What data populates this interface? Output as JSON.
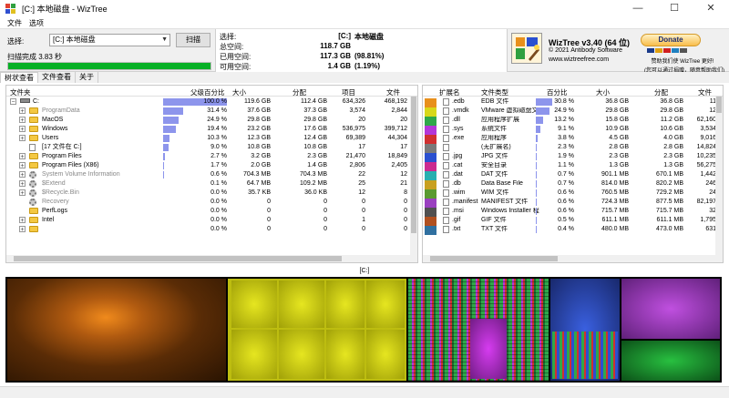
{
  "window": {
    "title": "[C:] 本地磁盘 - WizTree",
    "minimize": "—",
    "maximize": "☐",
    "close": "✕"
  },
  "menu": [
    "文件",
    "选项"
  ],
  "scan": {
    "select_label": "选择:",
    "drive_value": "[C:] 本地磁盘",
    "scan_button": "扫描",
    "status": "扫描完成 3.83 秒",
    "progress_percent": 100
  },
  "stats": {
    "select_label": "选择:",
    "select_value": "[C:]",
    "drive_name": "本地磁盘",
    "total_label": "总空间:",
    "total": "118.7 GB",
    "used_label": "已用空间:",
    "used": "117.3 GB",
    "used_pct": "(98.81%)",
    "free_label": "可用空间:",
    "free": "1.4 GB",
    "free_pct": "(1.19%)"
  },
  "about": {
    "name": "WizTree v3.40 (64 位)",
    "copyright": "© 2021 Antibody Software",
    "url": "www.wiztreefree.com",
    "donate": "Donate",
    "donate_note": "赞助我们使 WizTree 更好!",
    "help_note": "(您可以通过捐赠，随意帮助我们)"
  },
  "colors": {
    "bar": "#8d95ec",
    "progress": "#06b025",
    "folder": "#f4c842"
  },
  "tabs": [
    "树状查看",
    "文件查看",
    "关于"
  ],
  "tree": {
    "headers": {
      "name": "文件夹",
      "pct": "父级百分比",
      "size": "大小",
      "alloc": "分配",
      "items": "项目",
      "files": "文件"
    },
    "rows": [
      {
        "name": "C:",
        "pct": 100.0,
        "pct_text": "100.0 %",
        "size": "119.6 GB",
        "alloc": "112.4 GB",
        "items": "634,326",
        "files": "468,192",
        "depth": 0,
        "icon": "drive-icon",
        "expand": "−",
        "sys": false
      },
      {
        "name": "ProgramData",
        "pct": 31.4,
        "pct_text": "31.4 %",
        "size": "37.6 GB",
        "alloc": "37.3 GB",
        "items": "3,574",
        "files": "2,844",
        "depth": 1,
        "icon": "folder-icon",
        "expand": "+",
        "sys": true
      },
      {
        "name": "MacOS",
        "pct": 24.9,
        "pct_text": "24.9 %",
        "size": "29.8 GB",
        "alloc": "29.8 GB",
        "items": "20",
        "files": "20",
        "depth": 1,
        "icon": "folder-icon",
        "expand": "+",
        "sys": false
      },
      {
        "name": "Windows",
        "pct": 19.4,
        "pct_text": "19.4 %",
        "size": "23.2 GB",
        "alloc": "17.6 GB",
        "items": "536,975",
        "files": "399,712",
        "depth": 1,
        "icon": "folder-icon",
        "expand": "+",
        "sys": false
      },
      {
        "name": "Users",
        "pct": 10.3,
        "pct_text": "10.3 %",
        "size": "12.3 GB",
        "alloc": "12.4 GB",
        "items": "69,389",
        "files": "44,304",
        "depth": 1,
        "icon": "folder-icon",
        "expand": "+",
        "sys": false
      },
      {
        "name": "[17 文件在 C:]",
        "pct": 9.0,
        "pct_text": "9.0 %",
        "size": "10.8 GB",
        "alloc": "10.8 GB",
        "items": "17",
        "files": "17",
        "depth": 1,
        "icon": "file-icon",
        "expand": "",
        "sys": false
      },
      {
        "name": "Program Files",
        "pct": 2.7,
        "pct_text": "2.7 %",
        "size": "3.2 GB",
        "alloc": "2.3 GB",
        "items": "21,470",
        "files": "18,849",
        "depth": 1,
        "icon": "folder-icon",
        "expand": "+",
        "sys": false
      },
      {
        "name": "Program Files (X86)",
        "pct": 1.7,
        "pct_text": "1.7 %",
        "size": "2.0 GB",
        "alloc": "1.4 GB",
        "items": "2,806",
        "files": "2,405",
        "depth": 1,
        "icon": "folder-icon",
        "expand": "+",
        "sys": false
      },
      {
        "name": "System Volume Information",
        "pct": 0.6,
        "pct_text": "0.6 %",
        "size": "704.3 MB",
        "alloc": "704.3 MB",
        "items": "22",
        "files": "12",
        "depth": 1,
        "icon": "gear-icon",
        "expand": "+",
        "sys": true
      },
      {
        "name": "$Extend",
        "pct": 0.1,
        "pct_text": "0.1 %",
        "size": "64.7 MB",
        "alloc": "109.2 MB",
        "items": "25",
        "files": "21",
        "depth": 1,
        "icon": "gear-icon",
        "expand": "+",
        "sys": true
      },
      {
        "name": "$Recycle.Bin",
        "pct": 0.0,
        "pct_text": "0.0 %",
        "size": "35.7 KB",
        "alloc": "36.0 KB",
        "items": "12",
        "files": "8",
        "depth": 1,
        "icon": "gear-icon",
        "expand": "+",
        "sys": true
      },
      {
        "name": "Recovery",
        "pct": 0.0,
        "pct_text": "0.0 %",
        "size": "0",
        "alloc": "0",
        "items": "0",
        "files": "0",
        "depth": 1,
        "icon": "gear-icon",
        "expand": "",
        "sys": true
      },
      {
        "name": "PerfLogs",
        "pct": 0.0,
        "pct_text": "0.0 %",
        "size": "0",
        "alloc": "0",
        "items": "0",
        "files": "0",
        "depth": 1,
        "icon": "folder-icon",
        "expand": "",
        "sys": false
      },
      {
        "name": "Intel",
        "pct": 0.0,
        "pct_text": "0.0 %",
        "size": "0",
        "alloc": "0",
        "items": "1",
        "files": "0",
        "depth": 1,
        "icon": "folder-icon",
        "expand": "+",
        "sys": false
      },
      {
        "name": "",
        "pct": 0.0,
        "pct_text": "0.0 %",
        "size": "0",
        "alloc": "0",
        "items": "0",
        "files": "0",
        "depth": 1,
        "icon": "folder-icon",
        "expand": "+",
        "sys": false
      }
    ]
  },
  "ext": {
    "headers": {
      "ext": "扩展名",
      "type": "文件类型",
      "pct": "百分比",
      "size": "大小",
      "alloc": "分配",
      "files": "文件"
    },
    "rows": [
      {
        "color": "#e8901c",
        "ext": ".edb",
        "type": "EDB 文件",
        "pct": 30.8,
        "pct_text": "30.8 %",
        "size": "36.8 GB",
        "alloc": "36.8 GB",
        "files": "11"
      },
      {
        "color": "#d8d81a",
        "ext": ".vmdk",
        "type": "VMware 虚拟磁盘文",
        "pct": 24.9,
        "pct_text": "24.9 %",
        "size": "29.8 GB",
        "alloc": "29.8 GB",
        "files": "12"
      },
      {
        "color": "#2fa84a",
        "ext": ".dll",
        "type": "应用程序扩展",
        "pct": 13.2,
        "pct_text": "13.2 %",
        "size": "15.8 GB",
        "alloc": "11.2 GB",
        "files": "62,160"
      },
      {
        "color": "#b436d8",
        "ext": ".sys",
        "type": "系统文件",
        "pct": 9.1,
        "pct_text": "9.1 %",
        "size": "10.9 GB",
        "alloc": "10.6 GB",
        "files": "3,534"
      },
      {
        "color": "#d03030",
        "ext": ".exe",
        "type": "应用程序",
        "pct": 3.8,
        "pct_text": "3.8 %",
        "size": "4.5 GB",
        "alloc": "4.0 GB",
        "files": "9,016"
      },
      {
        "color": "#7a7a7a",
        "ext": "",
        "type": "(无扩展名)",
        "pct": 2.3,
        "pct_text": "2.3 %",
        "size": "2.8 GB",
        "alloc": "2.8 GB",
        "files": "14,824"
      },
      {
        "color": "#2a50d0",
        "ext": ".jpg",
        "type": "JPG 文件",
        "pct": 1.9,
        "pct_text": "1.9 %",
        "size": "2.3 GB",
        "alloc": "2.3 GB",
        "files": "10,235"
      },
      {
        "color": "#cc2a90",
        "ext": ".cat",
        "type": "安全目录",
        "pct": 1.1,
        "pct_text": "1.1 %",
        "size": "1.3 GB",
        "alloc": "1.3 GB",
        "files": "56,275"
      },
      {
        "color": "#28b0b0",
        "ext": ".dat",
        "type": "DAT 文件",
        "pct": 0.7,
        "pct_text": "0.7 %",
        "size": "901.1 MB",
        "alloc": "670.1 MB",
        "files": "1,442"
      },
      {
        "color": "#c8a020",
        "ext": ".db",
        "type": "Data Base File",
        "pct": 0.7,
        "pct_text": "0.7 %",
        "size": "814.0 MB",
        "alloc": "820.2 MB",
        "files": "246"
      },
      {
        "color": "#5a9a30",
        "ext": ".wim",
        "type": "WIM 文件",
        "pct": 0.6,
        "pct_text": "0.6 %",
        "size": "760.5 MB",
        "alloc": "729.2 MB",
        "files": "24"
      },
      {
        "color": "#9a40c0",
        "ext": ".manifest",
        "type": "MANIFEST 文件",
        "pct": 0.6,
        "pct_text": "0.6 %",
        "size": "724.3 MB",
        "alloc": "877.5 MB",
        "files": "82,197"
      },
      {
        "color": "#505050",
        "ext": ".msi",
        "type": "Windows Installer 程",
        "pct": 0.6,
        "pct_text": "0.6 %",
        "size": "715.7 MB",
        "alloc": "715.7 MB",
        "files": "32"
      },
      {
        "color": "#b05020",
        "ext": ".gif",
        "type": "GIF 文件",
        "pct": 0.5,
        "pct_text": "0.5 %",
        "size": "611.1 MB",
        "alloc": "611.1 MB",
        "files": "1,795"
      },
      {
        "color": "#3070a0",
        "ext": ".txt",
        "type": "TXT 文件",
        "pct": 0.4,
        "pct_text": "0.4 %",
        "size": "480.0 MB",
        "alloc": "473.0 MB",
        "files": "631"
      }
    ]
  },
  "treemap": {
    "label": "[C:]"
  }
}
